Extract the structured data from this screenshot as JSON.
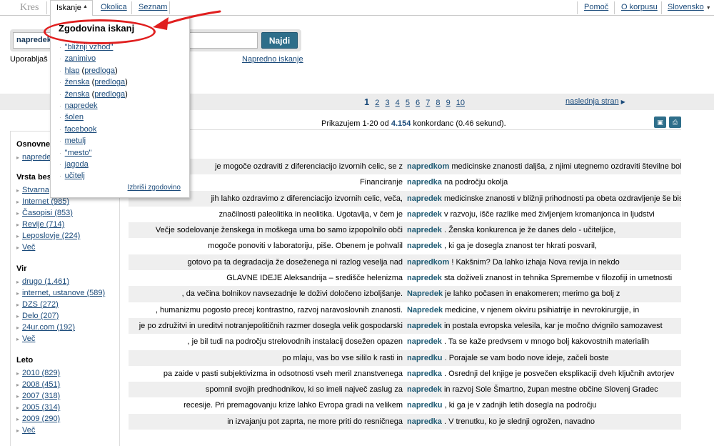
{
  "nav": {
    "brand": "Kres",
    "iskanje": "Iskanje",
    "okolica": "Okolica",
    "seznam": "Seznam",
    "pomoc": "Pomoč",
    "o_korpusu": "O korpusu",
    "language": "Slovensko"
  },
  "search": {
    "query": "napredek",
    "button": "Najdi",
    "uporabljas": "Uporabljaš",
    "advanced": "Napredno iskanje"
  },
  "history": {
    "title": "Zgodovina iskanj",
    "items": [
      {
        "text": "\"bližnji vzhod\"",
        "suffix": ""
      },
      {
        "text": "zanimivo",
        "suffix": ""
      },
      {
        "text": "hlap",
        "suffix": "predloga"
      },
      {
        "text": "ženska",
        "suffix": "predloga"
      },
      {
        "text": "ženska",
        "suffix": "predloga"
      },
      {
        "text": "napredek",
        "suffix": ""
      },
      {
        "text": "šolen",
        "suffix": ""
      },
      {
        "text": "facebook",
        "suffix": ""
      },
      {
        "text": "metulj",
        "suffix": ""
      },
      {
        "text": "\"mesto\"",
        "suffix": ""
      },
      {
        "text": "jagoda",
        "suffix": ""
      },
      {
        "text": "učitelj",
        "suffix": ""
      }
    ],
    "clear": "Izbriši zgodovino"
  },
  "pagination": {
    "pages": [
      "1",
      "2",
      "3",
      "4",
      "5",
      "6",
      "7",
      "8",
      "9",
      "10"
    ],
    "current": "1",
    "next": "naslednja stran"
  },
  "results": {
    "prefix": "Prikazujem 1-20 od",
    "count": "4.154",
    "suffix": "konkordanc (0.46 sekund)."
  },
  "sidebar": {
    "osnovne": {
      "title": "Osnovne",
      "items": [
        "napredek"
      ]
    },
    "vrsta": {
      "title": "Vrsta bes",
      "items": [
        "Stvarna",
        "Internet (985)",
        "Časopisi (853)",
        "Revije (714)",
        "Leposlovje (224)",
        "Več"
      ]
    },
    "vir": {
      "title": "Vir",
      "items": [
        "drugo (1.461)",
        "internet, ustanove (589)",
        "DZS (272)",
        "Delo (207)",
        "24ur.com (192)",
        "Več"
      ]
    },
    "leto": {
      "title": "Leto",
      "items": [
        "2010 (829)",
        "2008 (451)",
        "2007 (318)",
        "2005 (314)",
        "2009 (290)",
        "Več"
      ]
    }
  },
  "concordances": [
    {
      "left": "je mogoče ozdraviti z diferenciacijo izvornih celic, se z",
      "kw": "napredkom",
      "right": "medicinske znanosti daljša, z njimi utegnemo ozdraviti številne bolezni"
    },
    {
      "left": "Financiranje",
      "kw": "napredka",
      "right": "na področju okolja"
    },
    {
      "left": "jih lahko ozdravimo z diferenciacijo izvornih celic, veča,",
      "kw": "napredek",
      "right": "medicinske znanosti v bližnji prihodnosti pa obeta ozdravljenje še bistveno"
    },
    {
      "left": "značilnosti paleolitika in neolitika. Ugotavlja, v čem je",
      "kw": "napredek",
      "right": "v razvoju, išče razlike med življenjem kromanjonca in ljudstvi"
    },
    {
      "left": "Večje sodelovanje ženskega in moškega uma bo samo izpopolnilo obči",
      "kw": "napredek",
      "right": ". Ženska konkurenca je že danes delo - učiteljice,"
    },
    {
      "left": "mogoče ponoviti v laboratoriju, piše. Obenem je pohvalil",
      "kw": "napredek",
      "right": ", ki ga je dosegla znanost ter hkrati posvaril,"
    },
    {
      "left": "gotovo pa ta degradacija že doseženega ni razlog veselja nad",
      "kw": "napredkom",
      "right": "! Kakšnim? Da lahko izhaja Nova revija in nekdo"
    },
    {
      "left": "GLAVNE IDEJE Aleksandrija – središče helenizma",
      "kw": "napredek",
      "right": "sta doživeli znanost in tehnika Spremembe v filozofiji in umetnosti"
    },
    {
      "left": ", da večina bolnikov navsezadnje le doživi določeno izboljšanje.",
      "kw": "Napredek",
      "right": "je lahko počasen in enakomeren; merimo ga bolj z"
    },
    {
      "left": ", humanizmu pogosto precej kontrastno, razvoj naravoslovnih znanosti.",
      "kw": "Napredek",
      "right": "medicine, v njenem okviru psihiatrije in nevrokirurgije, in"
    },
    {
      "left": "je po združitvi in ureditvi notranjepolitičnih razmer dosegla velik gospodarski",
      "kw": "napredek",
      "right": "in postala evropska velesila, kar je močno dvignilo samozavest"
    },
    {
      "left": ", je bil tudi na področju strelovodnih instalacij dosežen opazen",
      "kw": "napredek",
      "right": ". Ta se kaže predvsem v mnogo bolj kakovostnih materialih"
    },
    {
      "left": "po mlaju, vas bo vse sililo k rasti in",
      "kw": "napredku",
      "right": ". Porajale se vam bodo nove ideje, začeli boste"
    },
    {
      "left": "pa zaide v pasti subjektivizma in odsotnosti vseh meril znanstvenega",
      "kw": "napredka",
      "right": ". Osrednji del knjige je posvečen eksplikaciji dveh ključnih avtorjev"
    },
    {
      "left": "spomnil svojih predhodnikov, ki so imeli največ zaslug za",
      "kw": "napredek",
      "right": "in razvoj Sole Šmartno, župan mestne občine Slovenj Gradec"
    },
    {
      "left": "recesije. Pri premagovanju krize lahko Evropa gradi na velikem",
      "kw": "napredku",
      "right": ", ki ga je v zadnjih letih dosegla na področju"
    },
    {
      "left": "in izvajanju pot zaprta, ne more priti do resničnega",
      "kw": "napredka",
      "right": ". V trenutku, ko je slednji ogrožen, navadno"
    }
  ],
  "colors": {
    "accent": "#2e6e8a",
    "link": "#1a4a7a",
    "keyword": "#1e5a73",
    "annotation": "#e01f1f"
  }
}
